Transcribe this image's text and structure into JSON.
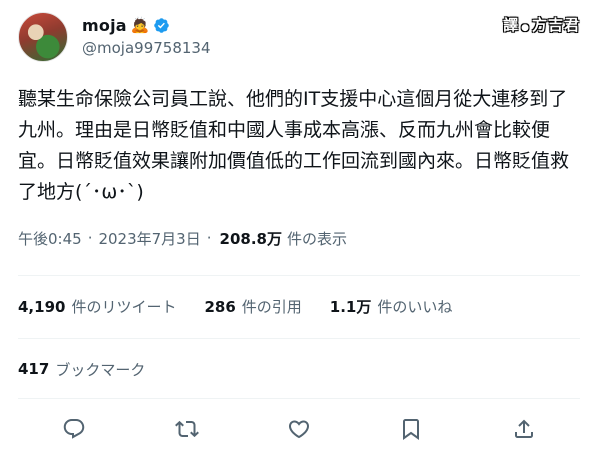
{
  "user": {
    "display_name": "moja",
    "emoji": "🙇",
    "handle": "@moja99758134",
    "avatar_icon": "avatar-photo",
    "verified_color": "#1d9bf0"
  },
  "watermark": {
    "left": "譯",
    "right": "方吉君"
  },
  "tweet": {
    "text": "聽某生命保險公司員工說、他們的IT支援中心這個月從大連移到了九州。理由是日幣貶值和中國人事成本高漲、反而九州會比較便宜。日幣貶值效果讓附加價值低的工作回流到國內來。日幣貶值救了地方(´･ω･`)"
  },
  "meta": {
    "time": "午後0:45",
    "date": "2023年7月3日",
    "views_count": "208.8万",
    "views_label": "件の表示"
  },
  "stats": {
    "retweets_count": "4,190",
    "retweets_label": "件のリツイート",
    "quotes_count": "286",
    "quotes_label": "件の引用",
    "likes_count": "1.1万",
    "likes_label": "件のいいね"
  },
  "bookmarks": {
    "count": "417",
    "label": "ブックマーク"
  },
  "actions": [
    "reply-icon",
    "retweet-icon",
    "like-icon",
    "bookmark-icon",
    "share-icon"
  ],
  "colors": {
    "icon": "#536471",
    "divider": "#eff3f4",
    "text": "#0f1419"
  }
}
